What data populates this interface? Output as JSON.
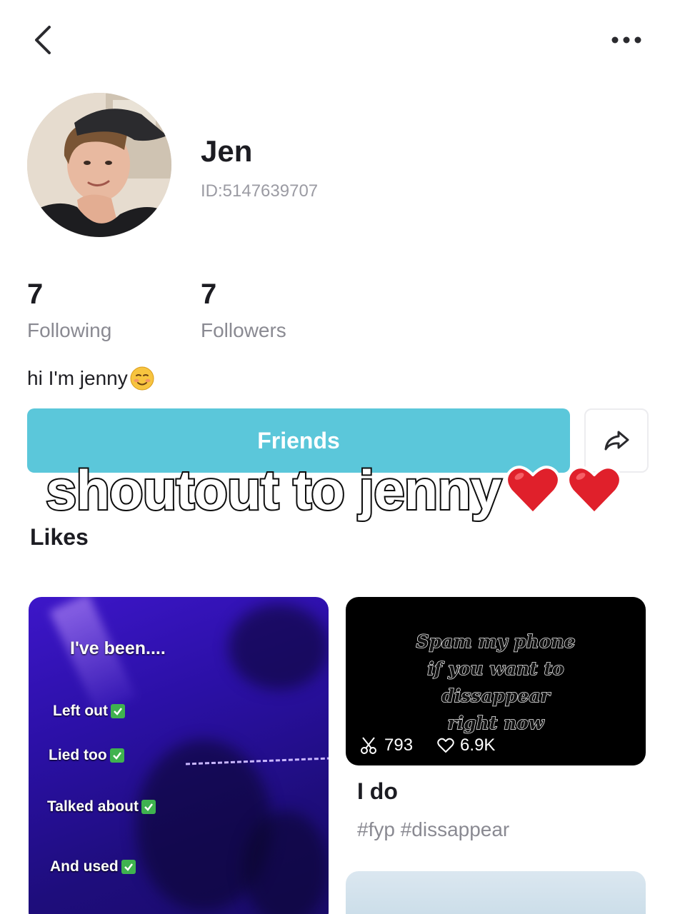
{
  "header": {
    "back_icon": "chevron-left-icon",
    "more_icon": "ellipsis-icon"
  },
  "profile": {
    "display_name": "Jen",
    "user_id": "ID:5147639707",
    "bio": "hi I'm jenny",
    "bio_emoji": "smiling-face-emoji"
  },
  "stats": {
    "following_count": "7",
    "following_label": "Following",
    "followers_count": "7",
    "followers_label": "Followers"
  },
  "actions": {
    "friends_label": "Friends",
    "share_icon": "share-arrow-icon",
    "accent_color": "#5bc7da"
  },
  "overlay_caption": {
    "text": "shoutout to jenny",
    "emoji": "red-heart-emoji"
  },
  "likes": {
    "section_title": "Likes",
    "left_card_lines": [
      "I've been....",
      "Left out",
      "Lied too",
      "Talked about",
      "And used"
    ],
    "right_card": {
      "overlay_text_lines": [
        "Spam my phone",
        "if you want to",
        "dissappear",
        "right now"
      ],
      "cut_count": "793",
      "like_count": "6.9K",
      "title": "I do",
      "tags": "#fyp #dissappear"
    }
  }
}
